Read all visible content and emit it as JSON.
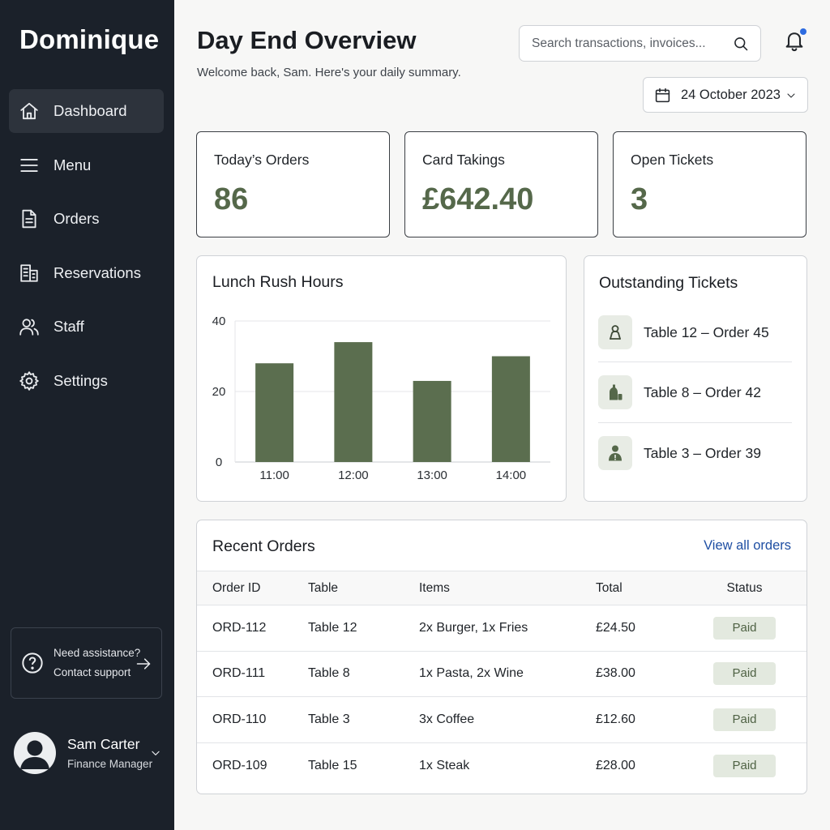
{
  "sidebar": {
    "brand": "Dominique",
    "items": [
      {
        "label": "Dashboard",
        "icon": "home-icon",
        "active": true
      },
      {
        "label": "Menu",
        "icon": "menu-icon",
        "active": false
      },
      {
        "label": "Orders",
        "icon": "document-icon",
        "active": false
      },
      {
        "label": "Reservations",
        "icon": "building-icon",
        "active": false
      },
      {
        "label": "Staff",
        "icon": "users-icon",
        "active": false
      },
      {
        "label": "Settings",
        "icon": "gear-icon",
        "active": false
      }
    ],
    "help": {
      "line1": "Need assistance?",
      "line2": "Contact support"
    },
    "user": {
      "name": "Sam Carter",
      "role": "Finance Manager"
    }
  },
  "header": {
    "title": "Day End Overview",
    "subtitle": "Welcome back, Sam. Here's your daily summary.",
    "search_placeholder": "Search transactions, invoices...",
    "date": "24 October 2023",
    "has_notification": true
  },
  "kpis": [
    {
      "label": "Today’s Orders",
      "value": "86"
    },
    {
      "label": "Card Takings",
      "value": "£642.40"
    },
    {
      "label": "Open Tickets",
      "value": "3"
    }
  ],
  "chart_title": "Lunch Rush Hours",
  "chart_data": {
    "type": "bar",
    "title": "Lunch Rush Hours",
    "categories": [
      "11:00",
      "12:00",
      "13:00",
      "14:00"
    ],
    "values": [
      28,
      34,
      23,
      30
    ],
    "ylim": [
      0,
      40
    ],
    "yticks": [
      "0",
      "20",
      "40"
    ],
    "grid": true,
    "color": "#5b6e4f"
  },
  "tickets": {
    "title": "Outstanding Tickets",
    "items": [
      {
        "label": "Table 12 – Order 45",
        "icon": "person-icon"
      },
      {
        "label": "Table 8 – Order 42",
        "icon": "bottle-icon"
      },
      {
        "label": "Table 3 – Order 39",
        "icon": "person-alert-icon"
      }
    ]
  },
  "recent_orders": {
    "title": "Recent Orders",
    "view_all": "View all orders",
    "columns": [
      "Order ID",
      "Table",
      "Items",
      "Total",
      "Status"
    ],
    "rows": [
      {
        "id": "ORD-112",
        "table": "Table 12",
        "items": "2x Burger, 1x Fries",
        "total": "£24.50",
        "status": "Paid"
      },
      {
        "id": "ORD-111",
        "table": "Table 8",
        "items": "1x Pasta, 2x Wine",
        "total": "£38.00",
        "status": "Paid"
      },
      {
        "id": "ORD-110",
        "table": "Table 3",
        "items": "3x Coffee",
        "total": "£12.60",
        "status": "Paid"
      },
      {
        "id": "ORD-109",
        "table": "Table 15",
        "items": "1x Steak",
        "total": "£28.00",
        "status": "Paid"
      }
    ]
  },
  "colors": {
    "accent": "#55684a",
    "sidebar": "#1b212a",
    "link": "#1f4fa3",
    "badge_bg": "#e3e9df"
  }
}
